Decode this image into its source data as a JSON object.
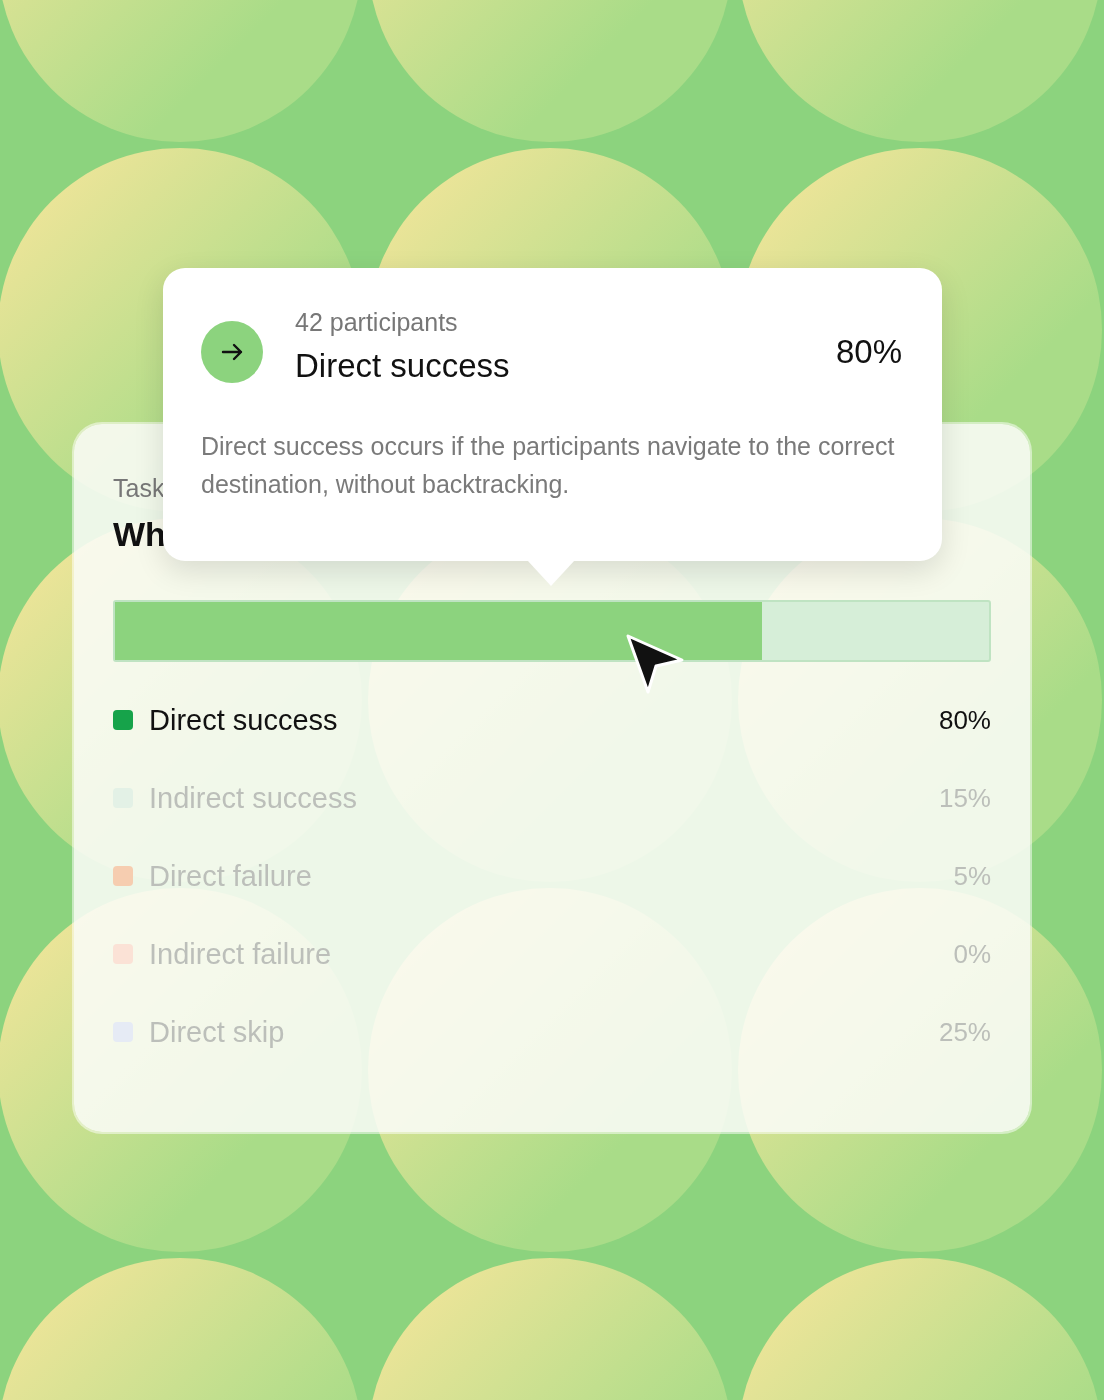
{
  "card": {
    "label": "Task",
    "question": "Wh",
    "bar": {
      "level": 0.74
    },
    "legend": [
      {
        "label": "Direct success",
        "value": "80%",
        "selected": true,
        "color": "#16a34a"
      },
      {
        "label": "Indirect success",
        "value": "15%",
        "selected": false,
        "color": "#e3f1e6"
      },
      {
        "label": "Direct failure",
        "value": "5%",
        "selected": false,
        "color": "#f6cdb0"
      },
      {
        "label": "Indirect failure",
        "value": "0%",
        "selected": false,
        "color": "#fbe2d6"
      },
      {
        "label": "Direct skip",
        "value": "25%",
        "selected": false,
        "color": "#e6ebf5"
      }
    ]
  },
  "tooltip": {
    "count": "42 participants",
    "title": "Direct success",
    "value": "80%",
    "description": "Direct success occurs if the participants navigate to the correct destination, without backtracking."
  }
}
